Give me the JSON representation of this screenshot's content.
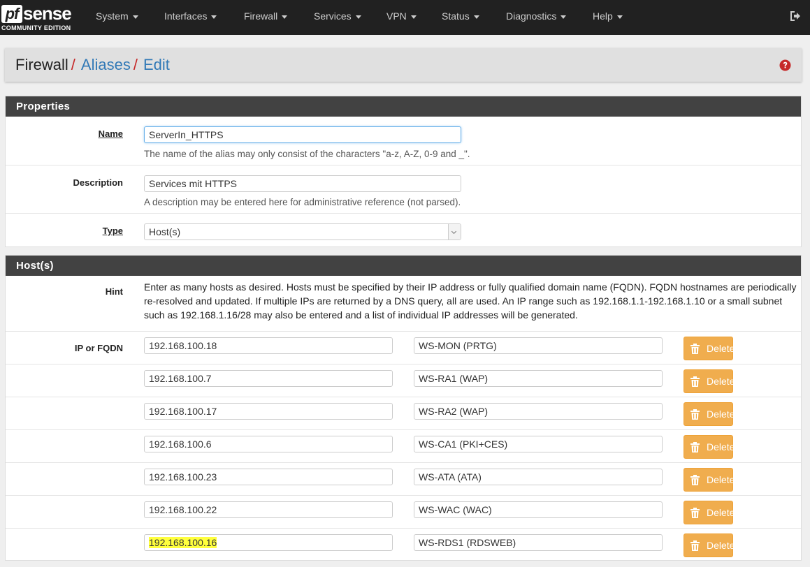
{
  "brand": {
    "name": "sense",
    "mark": "pf",
    "edition": "COMMUNITY EDITION"
  },
  "nav": {
    "items": [
      {
        "label": "System"
      },
      {
        "label": "Interfaces"
      },
      {
        "label": "Firewall"
      },
      {
        "label": "Services"
      },
      {
        "label": "VPN"
      },
      {
        "label": "Status"
      },
      {
        "label": "Diagnostics"
      },
      {
        "label": "Help"
      }
    ]
  },
  "breadcrumb": {
    "root": "Firewall",
    "section": "Aliases",
    "page": "Edit",
    "separator": "/"
  },
  "properties": {
    "title": "Properties",
    "name_label": "Name",
    "name_value": "ServerIn_HTTPS",
    "name_help": "The name of the alias may only consist of the characters \"a-z, A-Z, 0-9 and _\".",
    "description_label": "Description",
    "description_value": "Services mit HTTPS",
    "description_help": "A description may be entered here for administrative reference (not parsed).",
    "type_label": "Type",
    "type_value": "Host(s)"
  },
  "hosts": {
    "title": "Host(s)",
    "hint_label": "Hint",
    "hint_text": "Enter as many hosts as desired. Hosts must be specified by their IP address or fully qualified domain name (FQDN). FQDN hostnames are periodically re-resolved and updated. If multiple IPs are returned by a DNS query, all are used. An IP range such as 192.168.1.1-192.168.1.10 or a small subnet such as 192.168.1.16/28 may also be entered and a list of individual IP addresses will be generated.",
    "ip_label": "IP or FQDN",
    "delete_label": "Delete",
    "entries": [
      {
        "ip": "192.168.100.18",
        "desc": "WS-MON (PRTG)"
      },
      {
        "ip": "192.168.100.7",
        "desc": "WS-RA1 (WAP)"
      },
      {
        "ip": "192.168.100.17",
        "desc": "WS-RA2 (WAP)"
      },
      {
        "ip": "192.168.100.6",
        "desc": "WS-CA1 (PKI+CES)"
      },
      {
        "ip": "192.168.100.23",
        "desc": "WS-ATA (ATA)"
      },
      {
        "ip": "192.168.100.22",
        "desc": "WS-WAC (WAC)"
      },
      {
        "ip": "192.168.100.16",
        "desc": "WS-RDS1 (RDSWEB)"
      }
    ]
  },
  "colors": {
    "nav_bg": "#212121",
    "panel_head": "#424242",
    "link": "#337ab7",
    "separator": "#c62828",
    "delete_btn": "#f0ad4e",
    "highlight": "#ffff3d"
  }
}
